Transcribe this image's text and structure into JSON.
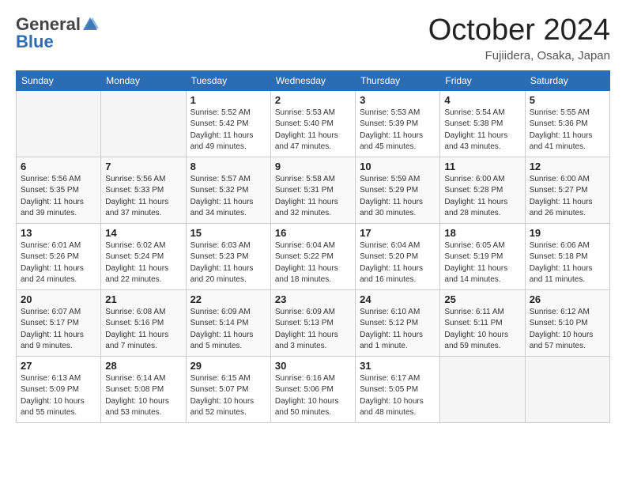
{
  "header": {
    "logo_general": "General",
    "logo_blue": "Blue",
    "month": "October 2024",
    "location": "Fujiidera, Osaka, Japan"
  },
  "weekdays": [
    "Sunday",
    "Monday",
    "Tuesday",
    "Wednesday",
    "Thursday",
    "Friday",
    "Saturday"
  ],
  "weeks": [
    [
      {
        "day": "",
        "info": ""
      },
      {
        "day": "",
        "info": ""
      },
      {
        "day": "1",
        "info": "Sunrise: 5:52 AM\nSunset: 5:42 PM\nDaylight: 11 hours and 49 minutes."
      },
      {
        "day": "2",
        "info": "Sunrise: 5:53 AM\nSunset: 5:40 PM\nDaylight: 11 hours and 47 minutes."
      },
      {
        "day": "3",
        "info": "Sunrise: 5:53 AM\nSunset: 5:39 PM\nDaylight: 11 hours and 45 minutes."
      },
      {
        "day": "4",
        "info": "Sunrise: 5:54 AM\nSunset: 5:38 PM\nDaylight: 11 hours and 43 minutes."
      },
      {
        "day": "5",
        "info": "Sunrise: 5:55 AM\nSunset: 5:36 PM\nDaylight: 11 hours and 41 minutes."
      }
    ],
    [
      {
        "day": "6",
        "info": "Sunrise: 5:56 AM\nSunset: 5:35 PM\nDaylight: 11 hours and 39 minutes."
      },
      {
        "day": "7",
        "info": "Sunrise: 5:56 AM\nSunset: 5:33 PM\nDaylight: 11 hours and 37 minutes."
      },
      {
        "day": "8",
        "info": "Sunrise: 5:57 AM\nSunset: 5:32 PM\nDaylight: 11 hours and 34 minutes."
      },
      {
        "day": "9",
        "info": "Sunrise: 5:58 AM\nSunset: 5:31 PM\nDaylight: 11 hours and 32 minutes."
      },
      {
        "day": "10",
        "info": "Sunrise: 5:59 AM\nSunset: 5:29 PM\nDaylight: 11 hours and 30 minutes."
      },
      {
        "day": "11",
        "info": "Sunrise: 6:00 AM\nSunset: 5:28 PM\nDaylight: 11 hours and 28 minutes."
      },
      {
        "day": "12",
        "info": "Sunrise: 6:00 AM\nSunset: 5:27 PM\nDaylight: 11 hours and 26 minutes."
      }
    ],
    [
      {
        "day": "13",
        "info": "Sunrise: 6:01 AM\nSunset: 5:26 PM\nDaylight: 11 hours and 24 minutes."
      },
      {
        "day": "14",
        "info": "Sunrise: 6:02 AM\nSunset: 5:24 PM\nDaylight: 11 hours and 22 minutes."
      },
      {
        "day": "15",
        "info": "Sunrise: 6:03 AM\nSunset: 5:23 PM\nDaylight: 11 hours and 20 minutes."
      },
      {
        "day": "16",
        "info": "Sunrise: 6:04 AM\nSunset: 5:22 PM\nDaylight: 11 hours and 18 minutes."
      },
      {
        "day": "17",
        "info": "Sunrise: 6:04 AM\nSunset: 5:20 PM\nDaylight: 11 hours and 16 minutes."
      },
      {
        "day": "18",
        "info": "Sunrise: 6:05 AM\nSunset: 5:19 PM\nDaylight: 11 hours and 14 minutes."
      },
      {
        "day": "19",
        "info": "Sunrise: 6:06 AM\nSunset: 5:18 PM\nDaylight: 11 hours and 11 minutes."
      }
    ],
    [
      {
        "day": "20",
        "info": "Sunrise: 6:07 AM\nSunset: 5:17 PM\nDaylight: 11 hours and 9 minutes."
      },
      {
        "day": "21",
        "info": "Sunrise: 6:08 AM\nSunset: 5:16 PM\nDaylight: 11 hours and 7 minutes."
      },
      {
        "day": "22",
        "info": "Sunrise: 6:09 AM\nSunset: 5:14 PM\nDaylight: 11 hours and 5 minutes."
      },
      {
        "day": "23",
        "info": "Sunrise: 6:09 AM\nSunset: 5:13 PM\nDaylight: 11 hours and 3 minutes."
      },
      {
        "day": "24",
        "info": "Sunrise: 6:10 AM\nSunset: 5:12 PM\nDaylight: 11 hours and 1 minute."
      },
      {
        "day": "25",
        "info": "Sunrise: 6:11 AM\nSunset: 5:11 PM\nDaylight: 10 hours and 59 minutes."
      },
      {
        "day": "26",
        "info": "Sunrise: 6:12 AM\nSunset: 5:10 PM\nDaylight: 10 hours and 57 minutes."
      }
    ],
    [
      {
        "day": "27",
        "info": "Sunrise: 6:13 AM\nSunset: 5:09 PM\nDaylight: 10 hours and 55 minutes."
      },
      {
        "day": "28",
        "info": "Sunrise: 6:14 AM\nSunset: 5:08 PM\nDaylight: 10 hours and 53 minutes."
      },
      {
        "day": "29",
        "info": "Sunrise: 6:15 AM\nSunset: 5:07 PM\nDaylight: 10 hours and 52 minutes."
      },
      {
        "day": "30",
        "info": "Sunrise: 6:16 AM\nSunset: 5:06 PM\nDaylight: 10 hours and 50 minutes."
      },
      {
        "day": "31",
        "info": "Sunrise: 6:17 AM\nSunset: 5:05 PM\nDaylight: 10 hours and 48 minutes."
      },
      {
        "day": "",
        "info": ""
      },
      {
        "day": "",
        "info": ""
      }
    ]
  ]
}
